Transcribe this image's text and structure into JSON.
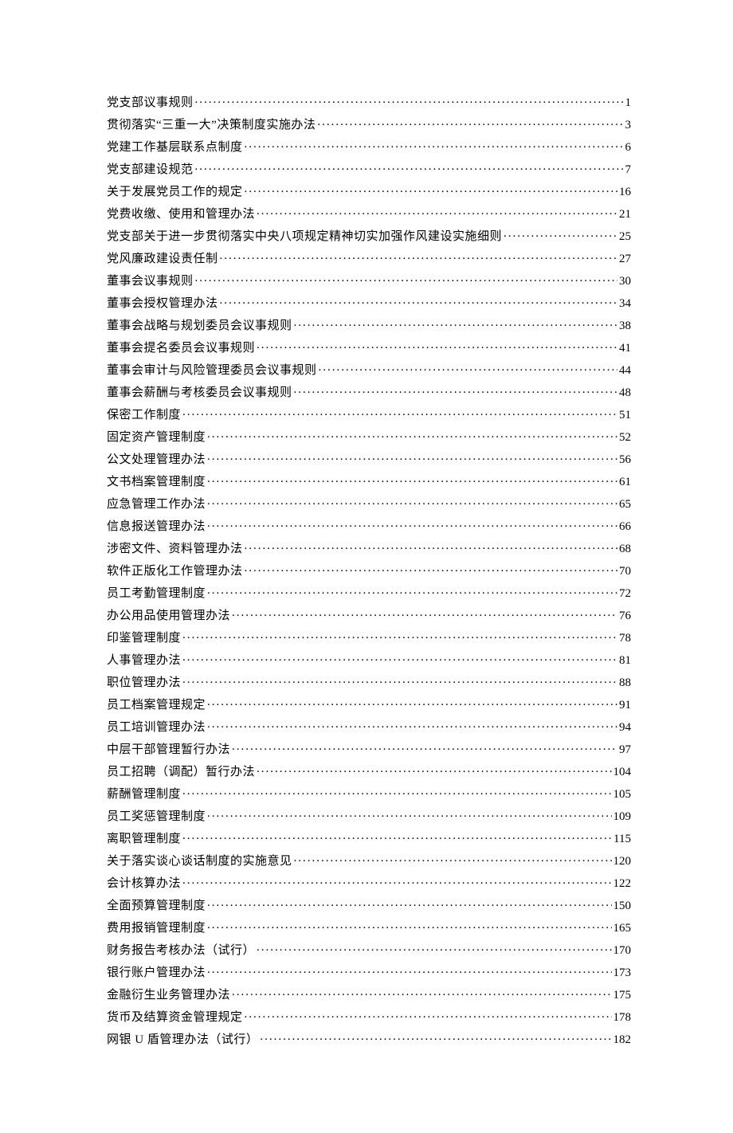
{
  "toc": [
    {
      "title": "党支部议事规则",
      "page": "1"
    },
    {
      "title": "贯彻落实“三重一大”决策制度实施办法",
      "page": "3"
    },
    {
      "title": "党建工作基层联系点制度",
      "page": "6"
    },
    {
      "title": "党支部建设规范",
      "page": "7"
    },
    {
      "title": "关于发展党员工作的规定",
      "page": "16"
    },
    {
      "title": "党费收缴、使用和管理办法",
      "page": "21"
    },
    {
      "title": "党支部关于进一步贯彻落实中央八项规定精神切实加强作风建设实施细则",
      "page": "25"
    },
    {
      "title": "党风廉政建设责任制",
      "page": "27"
    },
    {
      "title": "董事会议事规则",
      "page": "30"
    },
    {
      "title": "董事会授权管理办法",
      "page": "34"
    },
    {
      "title": "董事会战略与规划委员会议事规则",
      "page": "38"
    },
    {
      "title": "董事会提名委员会议事规则",
      "page": "41"
    },
    {
      "title": "董事会审计与风险管理委员会议事规则",
      "page": "44"
    },
    {
      "title": "董事会薪酬与考核委员会议事规则",
      "page": "48"
    },
    {
      "title": "保密工作制度",
      "page": "51"
    },
    {
      "title": "固定资产管理制度",
      "page": "52"
    },
    {
      "title": "公文处理管理办法",
      "page": "56"
    },
    {
      "title": "文书档案管理制度",
      "page": "61"
    },
    {
      "title": "应急管理工作办法",
      "page": "65"
    },
    {
      "title": "信息报送管理办法",
      "page": "66"
    },
    {
      "title": "涉密文件、资料管理办法",
      "page": "68"
    },
    {
      "title": "软件正版化工作管理办法",
      "page": "70"
    },
    {
      "title": "员工考勤管理制度",
      "page": "72"
    },
    {
      "title": "办公用品使用管理办法",
      "page": "76"
    },
    {
      "title": "印鉴管理制度",
      "page": "78"
    },
    {
      "title": "人事管理办法",
      "page": "81"
    },
    {
      "title": "职位管理办法",
      "page": "88"
    },
    {
      "title": "员工档案管理规定",
      "page": "91"
    },
    {
      "title": "员工培训管理办法",
      "page": "94"
    },
    {
      "title": "中层干部管理暂行办法",
      "page": "97"
    },
    {
      "title": "员工招聘（调配）暂行办法",
      "page": "104"
    },
    {
      "title": "薪酬管理制度",
      "page": "105"
    },
    {
      "title": "员工奖惩管理制度",
      "page": "109"
    },
    {
      "title": "离职管理制度",
      "page": "115"
    },
    {
      "title": "关于落实谈心谈话制度的实施意见",
      "page": "120"
    },
    {
      "title": "会计核算办法",
      "page": "122"
    },
    {
      "title": "全面预算管理制度",
      "page": "150"
    },
    {
      "title": "费用报销管理制度",
      "page": "165"
    },
    {
      "title": "财务报告考核办法（试行）",
      "page": "170"
    },
    {
      "title": "银行账户管理办法",
      "page": "173"
    },
    {
      "title": "金融衍生业务管理办法",
      "page": "175"
    },
    {
      "title": "货币及结算资金管理规定",
      "page": "178"
    },
    {
      "title": "网银 U 盾管理办法（试行）",
      "page": "182"
    }
  ]
}
